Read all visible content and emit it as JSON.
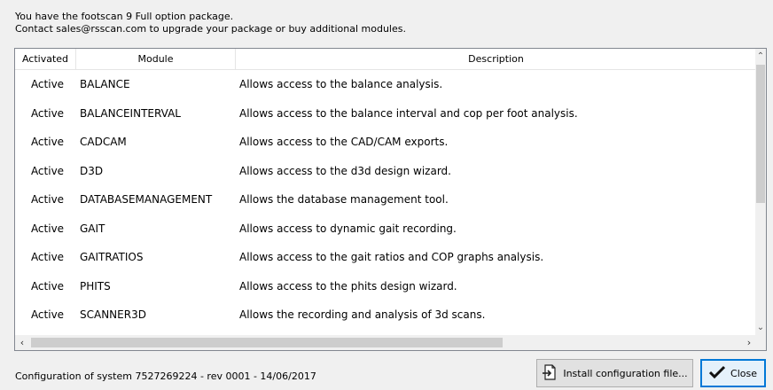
{
  "intro": {
    "line1": "You have the footscan 9 Full option package.",
    "line2": "Contact sales@rsscan.com to upgrade your package or buy additional modules."
  },
  "table": {
    "headers": {
      "activated": "Activated",
      "module": "Module",
      "description": "Description"
    },
    "rows": [
      {
        "activated": "Active",
        "module": "BALANCE",
        "description": "Allows access to the balance analysis."
      },
      {
        "activated": "Active",
        "module": "BALANCEINTERVAL",
        "description": "Allows access to the balance interval and cop per foot analysis."
      },
      {
        "activated": "Active",
        "module": "CADCAM",
        "description": "Allows access to the CAD/CAM exports."
      },
      {
        "activated": "Active",
        "module": "D3D",
        "description": "Allows access to the d3d design wizard."
      },
      {
        "activated": "Active",
        "module": "DATABASEMANAGEMENT",
        "description": "Allows the database management tool."
      },
      {
        "activated": "Active",
        "module": "GAIT",
        "description": "Allows access to dynamic gait recording."
      },
      {
        "activated": "Active",
        "module": "GAITRATIOS",
        "description": "Allows access to the gait ratios and COP graphs analysis."
      },
      {
        "activated": "Active",
        "module": "PHITS",
        "description": "Allows access to the phits design wizard."
      },
      {
        "activated": "Active",
        "module": "SCANNER3D",
        "description": "Allows the recording and analysis of 3d scans."
      }
    ]
  },
  "footer": {
    "config_text": "Configuration of system 7527269224 - rev 0001 - 14/06/2017",
    "install_label": "Install configuration file...",
    "close_label": "Close"
  },
  "icons": {
    "install": "import-file-icon",
    "close": "checkmark-icon"
  },
  "colors": {
    "close_border": "#0078d7",
    "close_bg": "#e5f1fb"
  }
}
